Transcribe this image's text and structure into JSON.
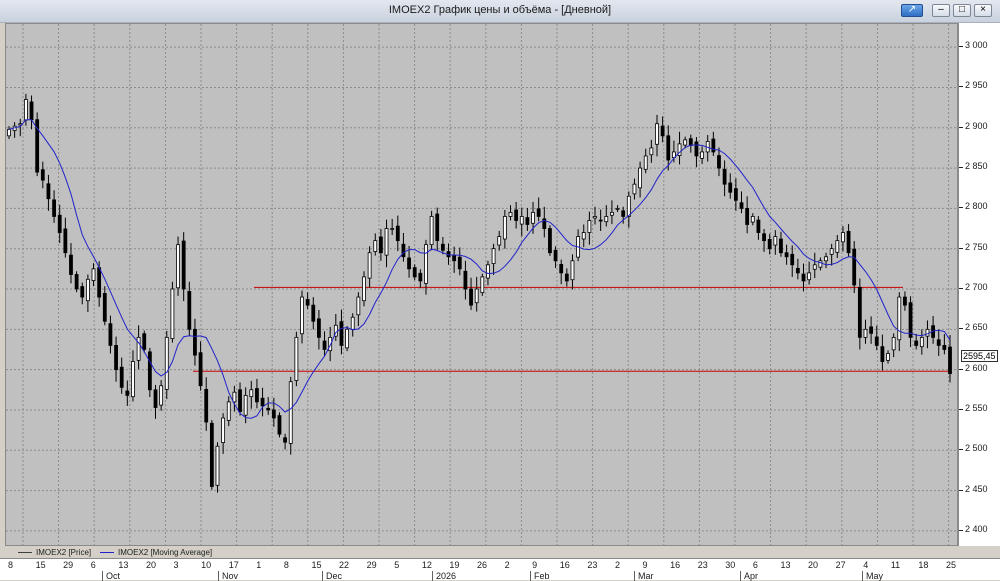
{
  "window": {
    "title": "IMOEX2 График цены и объёма - [Дневной]",
    "pin_icon": "pin-icon",
    "min_icon": "minimize-icon",
    "max_icon": "restore-icon",
    "close_icon": "close-icon"
  },
  "colors": {
    "plot_bg": "#c0c0c0",
    "grid": "#8c8c8c",
    "up_candle": "#ffffff",
    "down_candle": "#000000",
    "moving_average": "#2222cc",
    "level_line": "#cc0000"
  },
  "legend": {
    "price": "IMOEX2 [Price]",
    "ma": "IMOEX2 [Moving Average]"
  },
  "current_price_label": "2595,45",
  "chart_data": {
    "type": "candlestick",
    "ylim": [
      2380,
      3020
    ],
    "y_ticks": [
      "3 000",
      "2 950",
      "2 900",
      "2 850",
      "2 800",
      "2 750",
      "2 700",
      "2 650",
      "2 600",
      "2 550",
      "2 500",
      "2 450",
      "2 400"
    ],
    "y_tick_values": [
      3000,
      2950,
      2900,
      2850,
      2800,
      2750,
      2700,
      2650,
      2600,
      2550,
      2500,
      2450,
      2400
    ],
    "x_day_labels": [
      "8",
      "15",
      "29",
      "6",
      "13",
      "20",
      "3",
      "10",
      "17",
      "1",
      "8",
      "15",
      "22",
      "29",
      "5",
      "12",
      "19",
      "26",
      "2",
      "9",
      "16",
      "23",
      "2",
      "9",
      "16",
      "23",
      "30",
      "6",
      "13",
      "20",
      "27",
      "4",
      "11",
      "18",
      "25"
    ],
    "x_month_labels": [
      "Oct",
      "Nov",
      "Dec",
      "2026",
      "Feb",
      "Mar",
      "Apr",
      "May"
    ],
    "horizontal_levels": [
      2702,
      2598
    ],
    "close": [
      2898,
      2902,
      2905,
      2935,
      2910,
      2845,
      2835,
      2812,
      2790,
      2770,
      2745,
      2718,
      2700,
      2690,
      2712,
      2725,
      2690,
      2660,
      2630,
      2600,
      2578,
      2568,
      2610,
      2640,
      2625,
      2575,
      2553,
      2580,
      2640,
      2700,
      2755,
      2700,
      2650,
      2618,
      2580,
      2535,
      2455,
      2505,
      2540,
      2560,
      2572,
      2548,
      2568,
      2575,
      2560,
      2555,
      2550,
      2540,
      2520,
      2510,
      2585,
      2640,
      2690,
      2680,
      2660,
      2640,
      2625,
      2640,
      2655,
      2630,
      2650,
      2665,
      2690,
      2715,
      2745,
      2760,
      2745,
      2775,
      2775,
      2760,
      2740,
      2725,
      2715,
      2710,
      2755,
      2790,
      2760,
      2748,
      2740,
      2735,
      2725,
      2700,
      2680,
      2700,
      2715,
      2730,
      2750,
      2765,
      2790,
      2795,
      2785,
      2790,
      2780,
      2795,
      2790,
      2775,
      2745,
      2735,
      2720,
      2710,
      2735,
      2765,
      2770,
      2785,
      2790,
      2785,
      2790,
      2795,
      2800,
      2790,
      2815,
      2830,
      2850,
      2865,
      2875,
      2905,
      2890,
      2860,
      2870,
      2880,
      2885,
      2878,
      2865,
      2870,
      2883,
      2870,
      2850,
      2830,
      2820,
      2810,
      2800,
      2780,
      2790,
      2770,
      2760,
      2750,
      2765,
      2745,
      2740,
      2730,
      2720,
      2710,
      2720,
      2730,
      2735,
      2740,
      2750,
      2760,
      2770,
      2745,
      2705,
      2640,
      2650,
      2645,
      2630,
      2610,
      2620,
      2640,
      2690,
      2680,
      2640,
      2630,
      2640,
      2650,
      2640,
      2630,
      2625,
      2595
    ]
  }
}
